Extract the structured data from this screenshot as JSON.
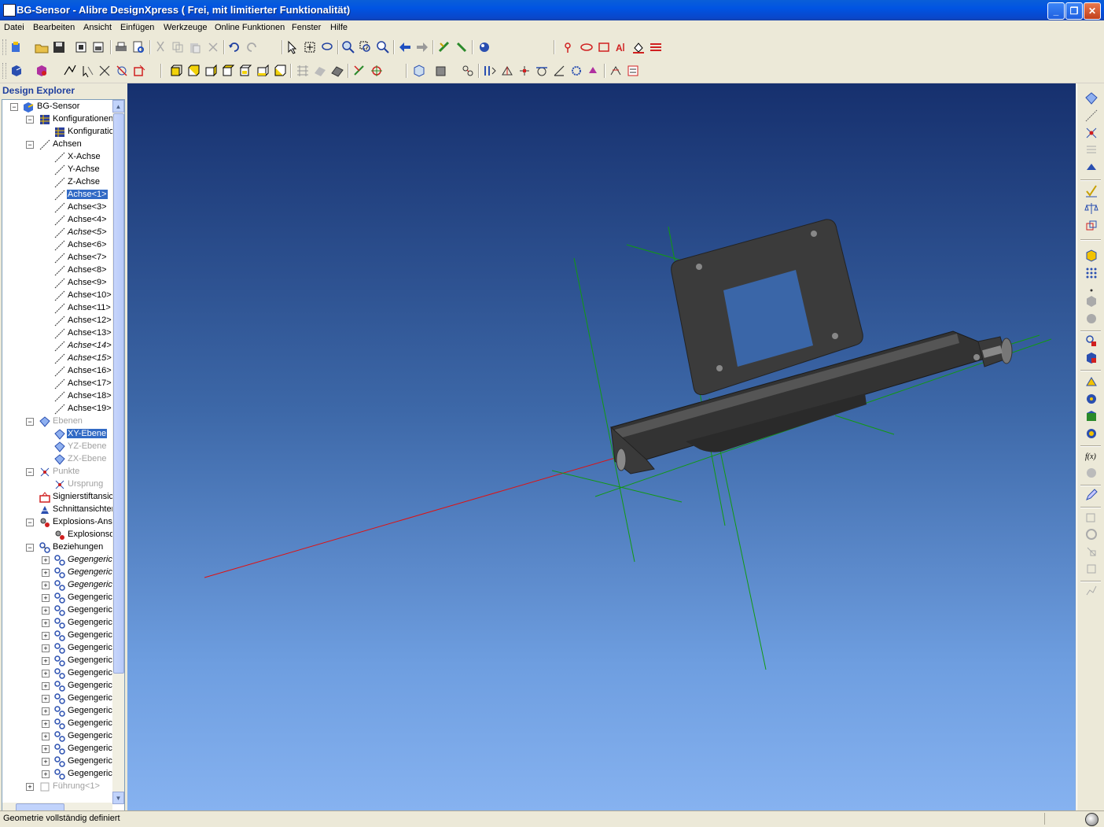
{
  "window": {
    "title": "BG-Sensor - Alibre DesignXpress ( Frei, mit limitierter Funktionalität)"
  },
  "menu": [
    "Datei",
    "Bearbeiten",
    "Ansicht",
    "Einfügen",
    "Werkzeuge",
    "Online Funktionen",
    "Fenster",
    "Hilfe"
  ],
  "explorer": {
    "title": "Design Explorer",
    "items": [
      "BG-Sensor",
      "Konfigurationen",
      "Konfiguration",
      "Achsen",
      "X-Achse",
      "Y-Achse",
      "Z-Achse",
      "Achse<1>",
      "Achse<3>",
      "Achse<4>",
      "Achse<5>",
      "Achse<6>",
      "Achse<7>",
      "Achse<8>",
      "Achse<9>",
      "Achse<10>",
      "Achse<11>",
      "Achse<12>",
      "Achse<13>",
      "Achse<14>",
      "Achse<15>",
      "Achse<16>",
      "Achse<17>",
      "Achse<18>",
      "Achse<19>",
      "Ebenen",
      "XY-Ebene",
      "YZ-Ebene",
      "ZX-Ebene",
      "Punkte",
      "Ursprung",
      "Signierstiftansichten",
      "Schnittansichten",
      "Explosions-Ansichten",
      "Explosionsdarstellung",
      "Beziehungen",
      "Gegengerichtet",
      "Gegengerichtet",
      "Gegengerichtet",
      "Gegengerichtet",
      "Gegengerichtet",
      "Gegengerichtet",
      "Gegengerichtet",
      "Gegengerichtet",
      "Gegengerichtet",
      "Gegengerichtet",
      "Gegengerichtet",
      "Gegengerichtet",
      "Gegengerichtet",
      "Gegengerichtet",
      "Gegengerichtet",
      "Gegengerichtet",
      "Gegengerichtet",
      "Gegengerichtet",
      "Führung<1>"
    ]
  },
  "status": {
    "text": "Geometrie vollständig definiert"
  },
  "colors": {
    "accent": "#316ac5",
    "axis_red": "#e01010",
    "axis_green": "#119911",
    "part": "#3a3a3a"
  }
}
